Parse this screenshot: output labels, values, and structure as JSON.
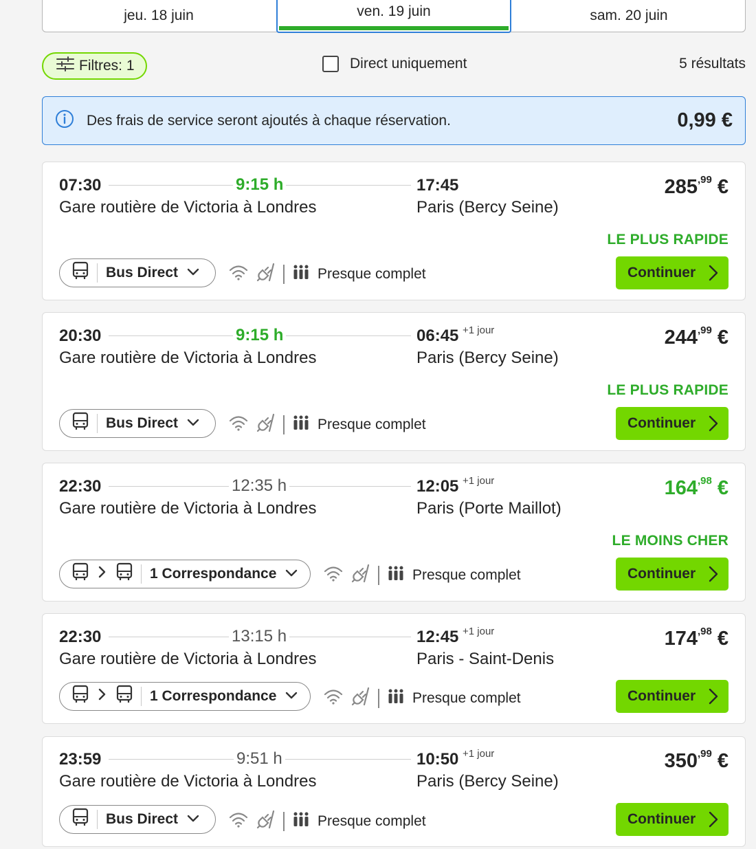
{
  "date_tabs": [
    {
      "label": "jeu. 18 juin",
      "active": false
    },
    {
      "label": "ven. 19 juin",
      "active": true
    },
    {
      "label": "sam. 20 juin",
      "active": false
    }
  ],
  "filters": {
    "filter_label": "Filtres: 1",
    "direct_only_label": "Direct uniquement",
    "results": "5 résultats"
  },
  "banner": {
    "text": "Des frais de service seront ajoutés à chaque réservation.",
    "fee": "0,99 €"
  },
  "colors": {
    "accent_green": "#73d700",
    "text_green": "#2eac2a",
    "info_blue": "#2f7fd8"
  },
  "trips": [
    {
      "dep_time": "07:30",
      "duration": "9:15 h",
      "arr_time": "17:45",
      "next_day": "",
      "dep_station": "Gare routière de Victoria à Londres",
      "arr_station": "Paris (Bercy Seine)",
      "price_main": "285",
      "price_cents": ",99",
      "price_currency": " €",
      "badge": "LE PLUS RAPIDE",
      "mode": "Bus Direct",
      "occupancy": "Presque complet",
      "continue_label": "Continuer"
    },
    {
      "dep_time": "20:30",
      "duration": "9:15 h",
      "arr_time": "06:45",
      "next_day": "+1 jour",
      "dep_station": "Gare routière de Victoria à Londres",
      "arr_station": "Paris (Bercy Seine)",
      "price_main": "244",
      "price_cents": ",99",
      "price_currency": " €",
      "badge": "LE PLUS RAPIDE",
      "mode": "Bus Direct",
      "occupancy": "Presque complet",
      "continue_label": "Continuer"
    },
    {
      "dep_time": "22:30",
      "duration": "12:35 h",
      "arr_time": "12:05",
      "next_day": "+1 jour",
      "dep_station": "Gare routière de Victoria à Londres",
      "arr_station": "Paris (Porte Maillot)",
      "price_main": "164",
      "price_cents": ",98",
      "price_currency": " €",
      "badge": "LE MOINS CHER",
      "mode": "1 Correspondance",
      "occupancy": "Presque complet",
      "continue_label": "Continuer"
    },
    {
      "dep_time": "22:30",
      "duration": "13:15 h",
      "arr_time": "12:45",
      "next_day": "+1 jour",
      "dep_station": "Gare routière de Victoria à Londres",
      "arr_station": "Paris - Saint-Denis",
      "price_main": "174",
      "price_cents": ",98",
      "price_currency": " €",
      "badge": "",
      "mode": "1 Correspondance",
      "occupancy": "Presque complet",
      "continue_label": "Continuer"
    },
    {
      "dep_time": "23:59",
      "duration": "9:51 h",
      "arr_time": "10:50",
      "next_day": "+1 jour",
      "dep_station": "Gare routière de Victoria à Londres",
      "arr_station": "Paris (Bercy Seine)",
      "price_main": "350",
      "price_cents": ",99",
      "price_currency": " €",
      "badge": "",
      "mode": "Bus Direct",
      "occupancy": "Presque complet",
      "continue_label": "Continuer"
    }
  ]
}
